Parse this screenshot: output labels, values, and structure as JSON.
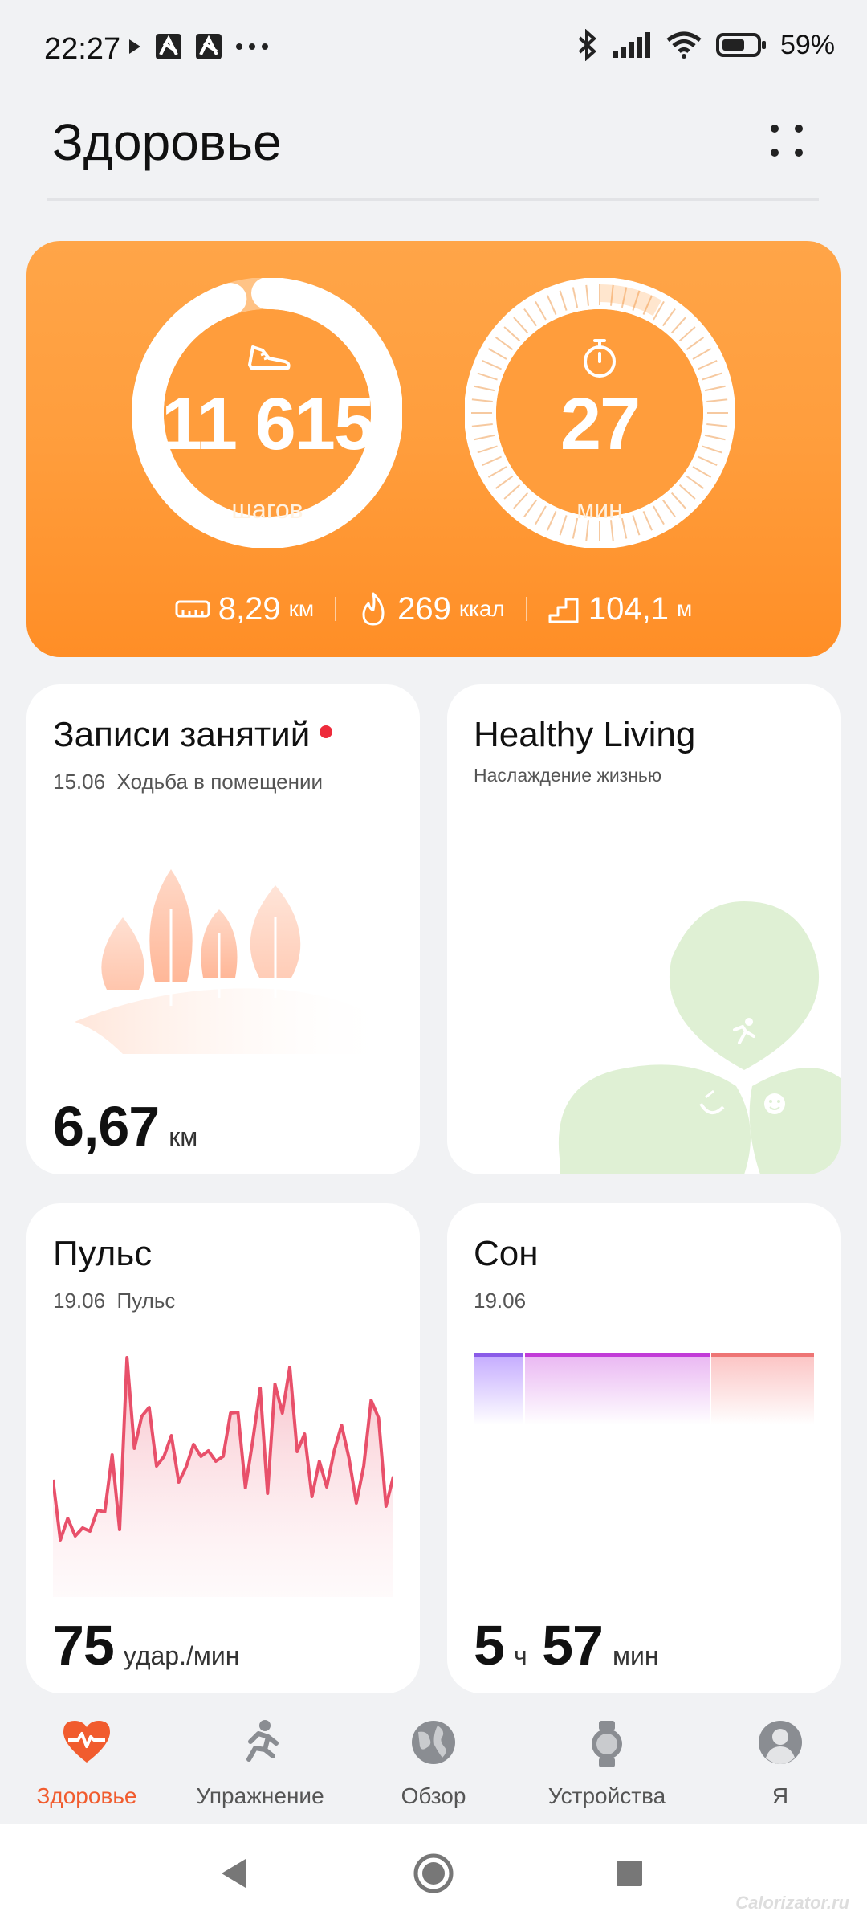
{
  "status": {
    "time": "22:27",
    "battery": "59%"
  },
  "header": {
    "title": "Здоровье"
  },
  "activity": {
    "steps_value": "11 615",
    "steps_unit": "шагов",
    "steps_progress": 0.95,
    "minutes_value": "27",
    "minutes_unit": "мин",
    "minutes_progress": 0.08,
    "distance_value": "8,29",
    "distance_unit": "км",
    "calories_value": "269",
    "calories_unit": "ккал",
    "floors_value": "104,1",
    "floors_unit": "м"
  },
  "cards": {
    "workouts": {
      "title": "Записи занятий",
      "date": "15.06",
      "type": "Ходьба в помещении",
      "value": "6,67",
      "unit": "км"
    },
    "healthy": {
      "title": "Healthy Living",
      "subtitle": "Наслаждение жизнью"
    },
    "pulse": {
      "title": "Пульс",
      "date": "19.06",
      "type": "Пульс",
      "value": "75",
      "unit": "удар./мин"
    },
    "sleep": {
      "title": "Сон",
      "date": "19.06",
      "hours": "5",
      "hours_unit": "ч",
      "minutes": "57",
      "minutes_unit": "мин"
    }
  },
  "nav": {
    "health": "Здоровье",
    "exercise": "Упражнение",
    "discover": "Обзор",
    "devices": "Устройства",
    "me": "Я"
  },
  "watermark": "Calorizator.ru",
  "colors": {
    "accent": "#f15c2e",
    "hero": "#ff9d3c",
    "pulse": "#e8506a",
    "leaf": "#dff0d4"
  },
  "pulse_series": [
    146,
    71,
    98,
    76,
    86,
    82,
    108,
    106,
    177,
    84,
    298,
    185,
    225,
    236,
    163,
    175,
    201,
    143,
    162,
    190,
    175,
    182,
    169,
    175,
    229,
    230,
    136,
    195,
    260,
    129,
    265,
    229,
    286,
    181,
    203,
    125,
    169,
    137,
    182,
    214,
    173,
    117,
    163,
    245,
    223,
    113,
    150
  ]
}
